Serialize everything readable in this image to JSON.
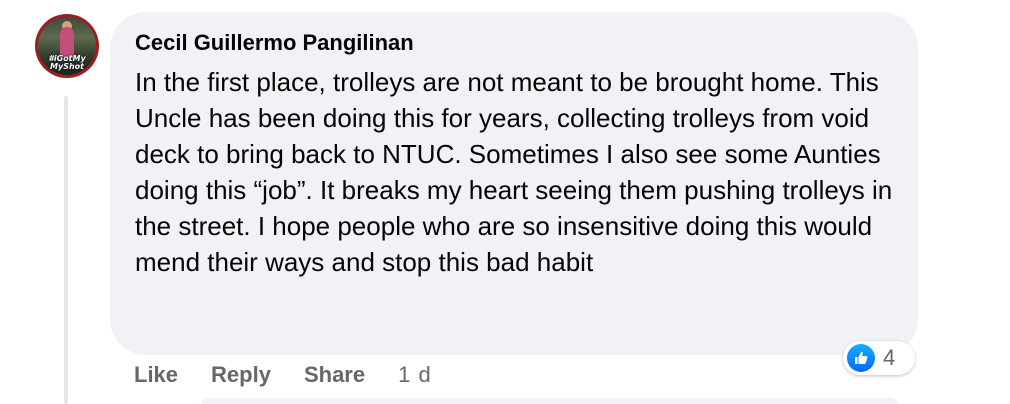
{
  "comment": {
    "author": "Cecil Guillermo Pangilinan",
    "text": "In the first place, trolleys are not meant to be brought home. This Uncle has been doing this for years, collecting trolleys from void deck to bring back to NTUC. Sometimes I also see some Aunties doing this “job”. It breaks my heart seeing them pushing trolleys in the street. I hope people who are so insensitive doing this would mend their ways and stop this bad habit",
    "avatar_frame_text": [
      "#iGotMy",
      "MyShot"
    ]
  },
  "actions": {
    "like": "Like",
    "reply": "Reply",
    "share": "Share",
    "timestamp": "1 d"
  },
  "reactions": {
    "icon": "thumbs-up-icon",
    "count": "4",
    "color": "#0866ff"
  }
}
